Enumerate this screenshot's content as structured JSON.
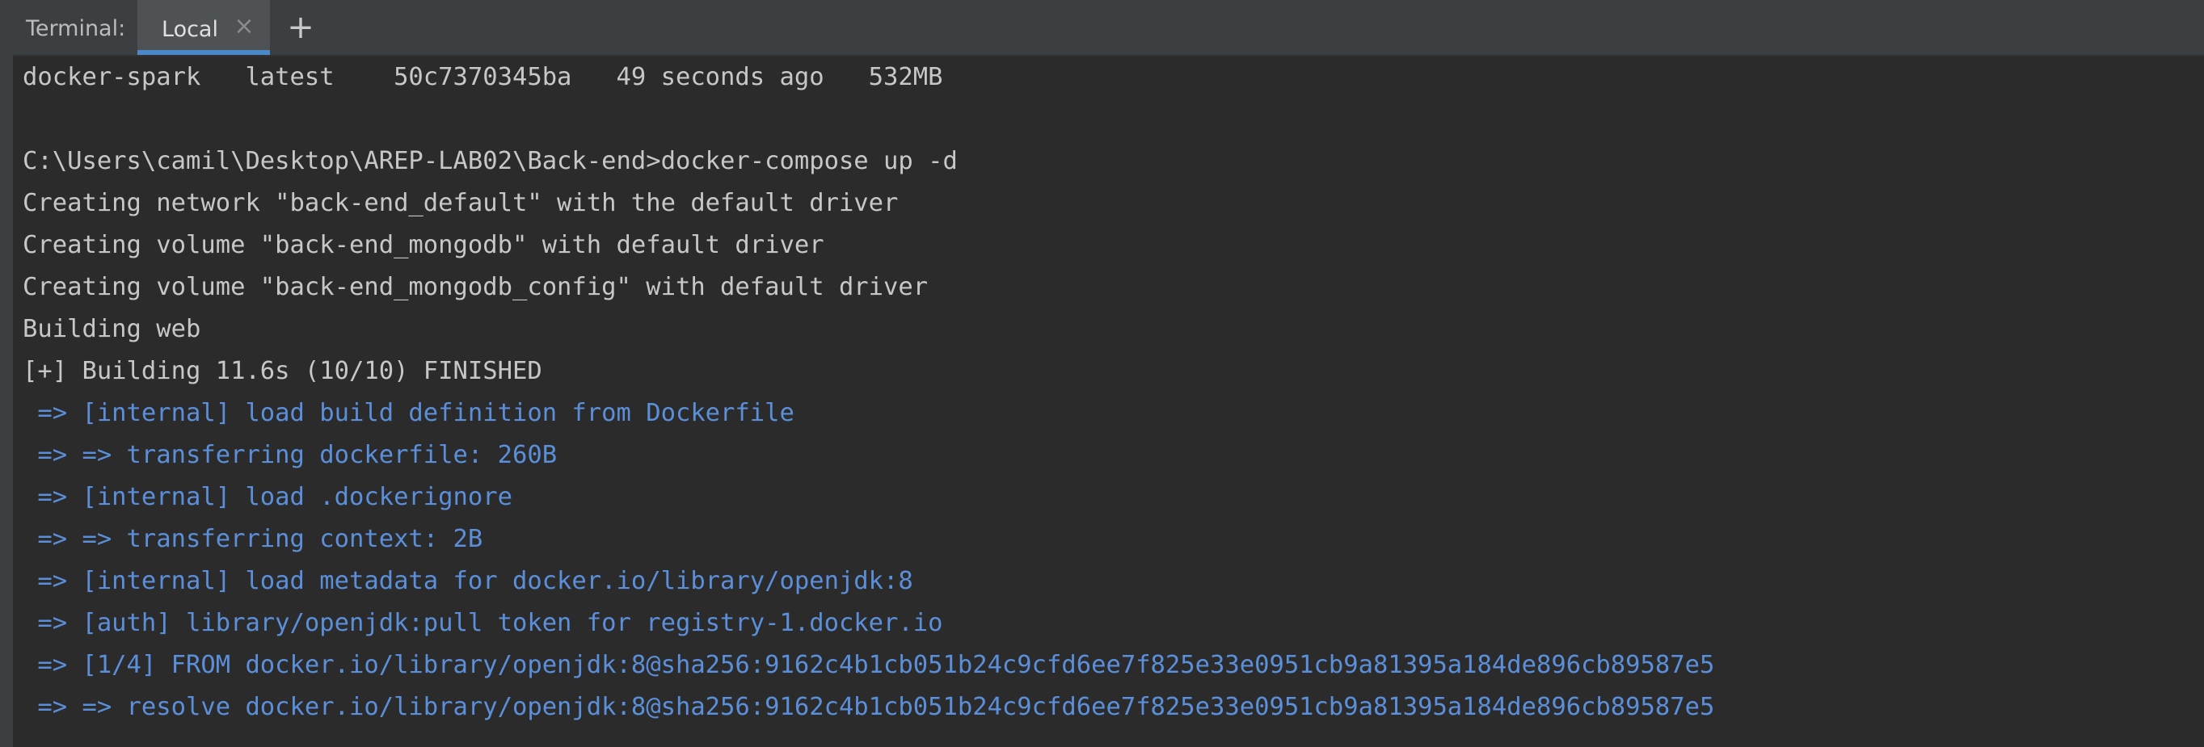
{
  "tool_window": {
    "label": "Terminal:",
    "tab": {
      "label": "Local",
      "close_icon": "×"
    },
    "add_icon": "+"
  },
  "colors": {
    "background": "#2b2b2b",
    "header_background": "#3c3f41",
    "tab_underline": "#4a88c7",
    "output_text": "#c7c7c7",
    "build_step_text": "#5b8fd9"
  },
  "terminal": {
    "lines": [
      {
        "text": "docker-spark   latest    50c7370345ba   49 seconds ago   532MB",
        "style": "default"
      },
      {
        "text": "",
        "style": "default"
      },
      {
        "text": "C:\\Users\\camil\\Desktop\\AREP-LAB02\\Back-end>docker-compose up -d",
        "style": "default"
      },
      {
        "text": "Creating network \"back-end_default\" with the default driver",
        "style": "default"
      },
      {
        "text": "Creating volume \"back-end_mongodb\" with default driver",
        "style": "default"
      },
      {
        "text": "Creating volume \"back-end_mongodb_config\" with default driver",
        "style": "default"
      },
      {
        "text": "Building web",
        "style": "default"
      },
      {
        "text": "[+] Building 11.6s (10/10) FINISHED",
        "style": "default"
      },
      {
        "text": " => [internal] load build definition from Dockerfile",
        "style": "blue"
      },
      {
        "text": " => => transferring dockerfile: 260B",
        "style": "blue"
      },
      {
        "text": " => [internal] load .dockerignore",
        "style": "blue"
      },
      {
        "text": " => => transferring context: 2B",
        "style": "blue"
      },
      {
        "text": " => [internal] load metadata for docker.io/library/openjdk:8",
        "style": "blue"
      },
      {
        "text": " => [auth] library/openjdk:pull token for registry-1.docker.io",
        "style": "blue"
      },
      {
        "text": " => [1/4] FROM docker.io/library/openjdk:8@sha256:9162c4b1cb051b24c9cfd6ee7f825e33e0951cb9a81395a184de896cb89587e5",
        "style": "blue"
      },
      {
        "text": " => => resolve docker.io/library/openjdk:8@sha256:9162c4b1cb051b24c9cfd6ee7f825e33e0951cb9a81395a184de896cb89587e5",
        "style": "blue"
      }
    ]
  }
}
